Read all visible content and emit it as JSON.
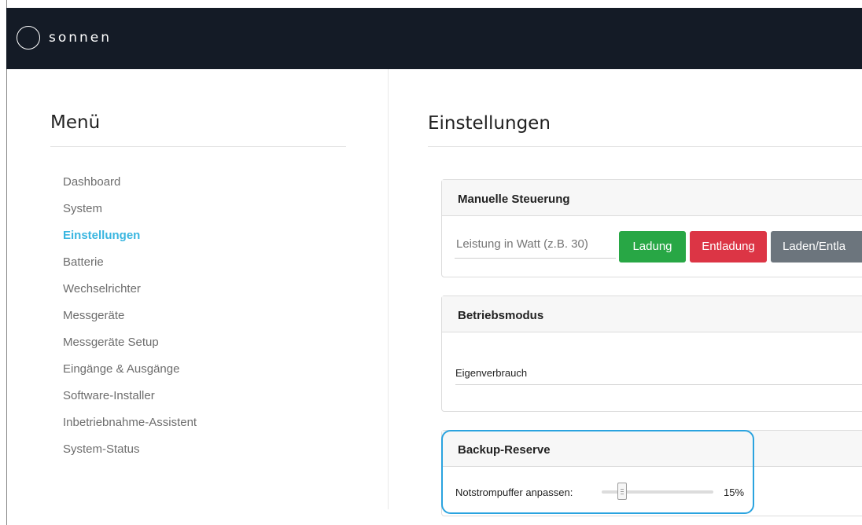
{
  "brand": {
    "name": "sonnen"
  },
  "sidebar": {
    "title": "Menü",
    "items": [
      {
        "label": "Dashboard"
      },
      {
        "label": "System"
      },
      {
        "label": "Einstellungen"
      },
      {
        "label": "Batterie"
      },
      {
        "label": "Wechselrichter"
      },
      {
        "label": "Messgeräte"
      },
      {
        "label": "Messgeräte Setup"
      },
      {
        "label": "Eingänge & Ausgänge"
      },
      {
        "label": "Software-Installer"
      },
      {
        "label": "Inbetriebnahme-Assistent"
      },
      {
        "label": "System-Status"
      }
    ],
    "active_item": "Einstellungen"
  },
  "main": {
    "title": "Einstellungen",
    "manual": {
      "header": "Manuelle Steuerung",
      "input_placeholder": "Leistung in Watt (z.B. 30)",
      "input_value": "",
      "charge_label": "Ladung",
      "discharge_label": "Entladung",
      "combined_label": "Laden/Entla"
    },
    "mode": {
      "header": "Betriebsmodus",
      "selected": "Eigenverbrauch"
    },
    "backup": {
      "header": "Backup-Reserve",
      "slider_label": "Notstrompuffer anpassen:",
      "slider_value": 15,
      "slider_display": "15%"
    }
  },
  "colors": {
    "topbar": "#141b26",
    "active_link": "#3ab6e0",
    "success": "#28a745",
    "danger": "#dc3545",
    "secondary": "#6c757d",
    "highlight": "#2aa3df"
  }
}
